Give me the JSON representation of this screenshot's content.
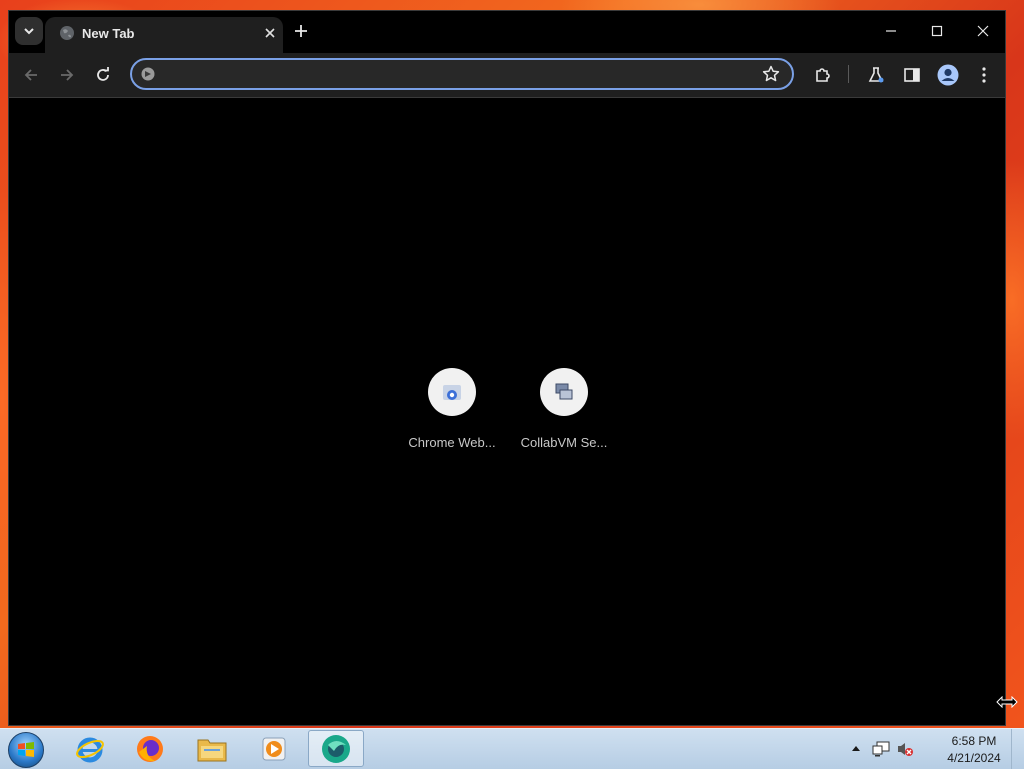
{
  "window": {
    "tab_title": "New Tab"
  },
  "toolbar": {
    "omnibox_value": ""
  },
  "shortcuts": [
    {
      "label": "Chrome Web..."
    },
    {
      "label": "CollabVM Se..."
    }
  ],
  "taskbar": {
    "pinned": [
      "internet-explorer-icon",
      "firefox-icon",
      "file-explorer-icon",
      "media-player-icon",
      "chrome-icon"
    ],
    "clock_time": "6:58 PM",
    "clock_date": "4/21/2024"
  },
  "colors": {
    "omnibox_border": "#7aa0e6",
    "window_bg": "#000000",
    "toolbar_bg": "#1f1f1f",
    "taskbar_bg": "#b6cde4"
  }
}
